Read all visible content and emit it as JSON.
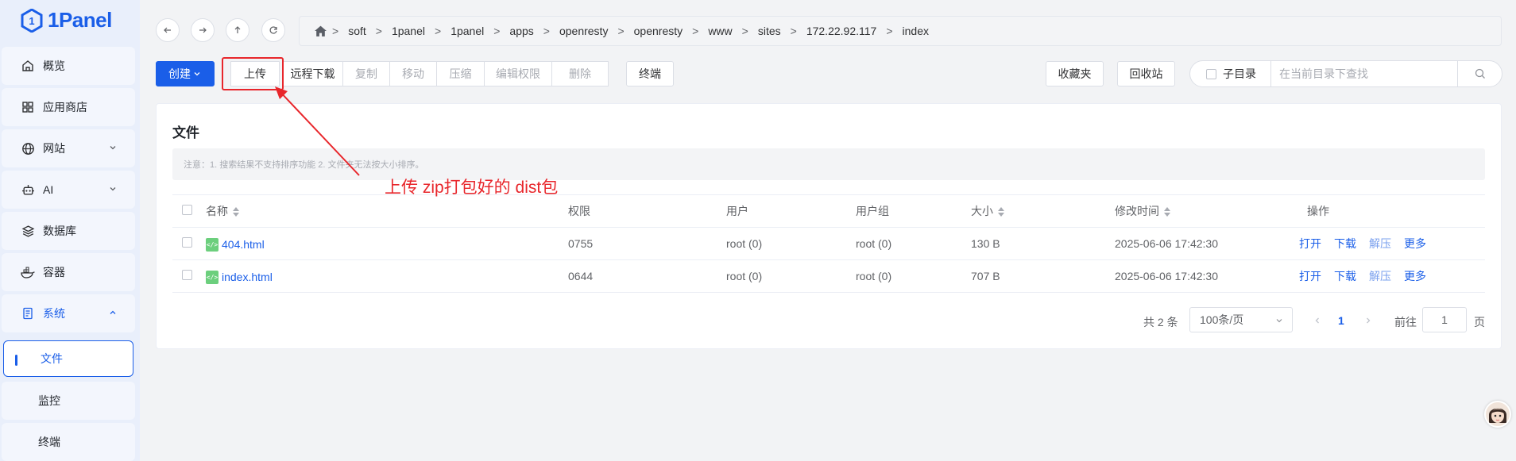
{
  "app": {
    "logo_text": "1Panel"
  },
  "sidebar": {
    "items": [
      {
        "label": "概览"
      },
      {
        "label": "应用商店"
      },
      {
        "label": "网站"
      },
      {
        "label": "AI"
      },
      {
        "label": "数据库"
      },
      {
        "label": "容器"
      },
      {
        "label": "系统"
      },
      {
        "label": "文件"
      },
      {
        "label": "监控"
      },
      {
        "label": "终端"
      }
    ]
  },
  "breadcrumb": [
    "soft",
    "1panel",
    "1panel",
    "apps",
    "openresty",
    "openresty",
    "www",
    "sites",
    "172.22.92.117",
    "index"
  ],
  "toolbar": {
    "create": "创建",
    "upload": "上传",
    "remote_download": "远程下载",
    "copy": "复制",
    "move": "移动",
    "compress": "压缩",
    "edit_permission": "编辑权限",
    "delete": "删除",
    "terminal": "终端",
    "favorites": "收藏夹",
    "recycle_bin": "回收站",
    "subdir": "子目录",
    "search_placeholder": "在当前目录下查找"
  },
  "card": {
    "title": "文件",
    "notice": "注意：1. 搜索结果不支持排序功能 2. 文件夹无法按大小排序。",
    "annotation": "上传 zip打包好的 dist包"
  },
  "table": {
    "headers": {
      "name": "名称",
      "perm": "权限",
      "user": "用户",
      "group": "用户组",
      "size": "大小",
      "mtime": "修改时间",
      "ops": "操作"
    },
    "rows": [
      {
        "name": "404.html",
        "perm": "0755",
        "user": "root (0)",
        "group": "root (0)",
        "size": "130 B",
        "mtime": "2025-06-06 17:42:30"
      },
      {
        "name": "index.html",
        "perm": "0644",
        "user": "root (0)",
        "group": "root (0)",
        "size": "707 B",
        "mtime": "2025-06-06 17:42:30"
      }
    ],
    "ops": {
      "open": "打开",
      "download": "下载",
      "extract": "解压",
      "more": "更多"
    }
  },
  "pagination": {
    "total": "共 2 条",
    "page_size": "100条/页",
    "current_page": "1",
    "goto_label": "前往",
    "goto_value": "1",
    "page_suffix": "页"
  },
  "colors": {
    "accent": "#1a5ee8",
    "annotation": "#e8262b"
  }
}
